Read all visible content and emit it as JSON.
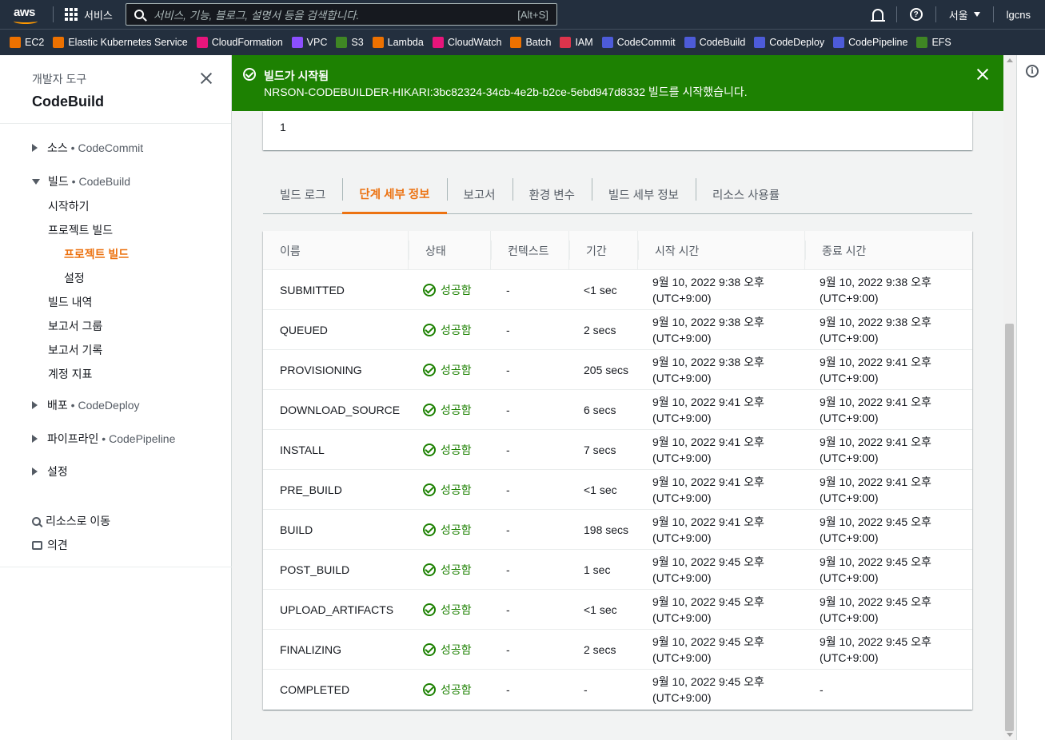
{
  "topnav": {
    "logo_text": "aws",
    "services_label": "서비스",
    "search_placeholder": "서비스, 기능, 블로그, 설명서 등을 검색합니다.",
    "search_shortcut": "[Alt+S]",
    "region": "서울",
    "account": "lgcns"
  },
  "favorites": [
    {
      "label": "EC2",
      "icon": "ec2-icon",
      "color": "#ed7100"
    },
    {
      "label": "Elastic Kubernetes Service",
      "icon": "eks-icon",
      "color": "#ed7100"
    },
    {
      "label": "CloudFormation",
      "icon": "cloudformation-icon",
      "color": "#e7157b"
    },
    {
      "label": "VPC",
      "icon": "vpc-icon",
      "color": "#8c4fff"
    },
    {
      "label": "S3",
      "icon": "s3-icon",
      "color": "#3f8624"
    },
    {
      "label": "Lambda",
      "icon": "lambda-icon",
      "color": "#ed7100"
    },
    {
      "label": "CloudWatch",
      "icon": "cloudwatch-icon",
      "color": "#e7157b"
    },
    {
      "label": "Batch",
      "icon": "batch-icon",
      "color": "#ed7100"
    },
    {
      "label": "IAM",
      "icon": "iam-icon",
      "color": "#dd344c"
    },
    {
      "label": "CodeCommit",
      "icon": "codecommit-icon",
      "color": "#4d5bd9"
    },
    {
      "label": "CodeBuild",
      "icon": "codebuild-icon",
      "color": "#4d5bd9"
    },
    {
      "label": "CodeDeploy",
      "icon": "codedeploy-icon",
      "color": "#4d5bd9"
    },
    {
      "label": "CodePipeline",
      "icon": "codepipeline-icon",
      "color": "#4d5bd9"
    },
    {
      "label": "EFS",
      "icon": "efs-icon",
      "color": "#3f8624"
    }
  ],
  "sidebar": {
    "subtitle": "개발자 도구",
    "title": "CodeBuild",
    "sections": {
      "source": {
        "label": "소스",
        "service": "CodeCommit"
      },
      "build": {
        "label": "빌드",
        "service": "CodeBuild"
      },
      "deploy": {
        "label": "배포",
        "service": "CodeDeploy"
      },
      "pipeline": {
        "label": "파이프라인",
        "service": "CodePipeline"
      },
      "settings": {
        "label": "설정"
      }
    },
    "bullet": "•",
    "build_items": {
      "getting_started": "시작하기",
      "build_projects": "프로젝트 빌드",
      "build_projects_active": "프로젝트 빌드",
      "settings": "설정",
      "build_history": "빌드 내역",
      "report_groups": "보고서 그룹",
      "report_history": "보고서 기록",
      "account_metrics": "계정 지표"
    },
    "go_to_resource": "리소스로 이동",
    "feedback": "의견"
  },
  "flash": {
    "title": "빌드가 시작됨",
    "message": "NRSON-CODEBUILDER-HIKARI:3bc82324-34cb-4e2b-b2ce-5ebd947d8332 빌드를 시작했습니다.",
    "color": "#1d8102"
  },
  "topcard_value": "1",
  "tabs": [
    "빌드 로그",
    "단계 세부 정보",
    "보고서",
    "환경 변수",
    "빌드 세부 정보",
    "리소스 사용률"
  ],
  "active_tab": "단계 세부 정보",
  "table": {
    "headers": {
      "name": "이름",
      "status": "상태",
      "context": "컨텍스트",
      "duration": "기간",
      "start": "시작 시간",
      "end": "종료 시간"
    },
    "rows": [
      {
        "name": "SUBMITTED",
        "status": "성공함",
        "context": "-",
        "duration": "<1 sec",
        "start": "9월 10, 2022 9:38 오후",
        "start_tz": "(UTC+9:00)",
        "end": "9월 10, 2022 9:38 오후",
        "end_tz": "(UTC+9:00)"
      },
      {
        "name": "QUEUED",
        "status": "성공함",
        "context": "-",
        "duration": "2 secs",
        "start": "9월 10, 2022 9:38 오후",
        "start_tz": "(UTC+9:00)",
        "end": "9월 10, 2022 9:38 오후",
        "end_tz": "(UTC+9:00)"
      },
      {
        "name": "PROVISIONING",
        "status": "성공함",
        "context": "-",
        "duration": "205 secs",
        "start": "9월 10, 2022 9:38 오후",
        "start_tz": "(UTC+9:00)",
        "end": "9월 10, 2022 9:41 오후",
        "end_tz": "(UTC+9:00)"
      },
      {
        "name": "DOWNLOAD_SOURCE",
        "status": "성공함",
        "context": "-",
        "duration": "6 secs",
        "start": "9월 10, 2022 9:41 오후",
        "start_tz": "(UTC+9:00)",
        "end": "9월 10, 2022 9:41 오후",
        "end_tz": "(UTC+9:00)"
      },
      {
        "name": "INSTALL",
        "status": "성공함",
        "context": "-",
        "duration": "7 secs",
        "start": "9월 10, 2022 9:41 오후",
        "start_tz": "(UTC+9:00)",
        "end": "9월 10, 2022 9:41 오후",
        "end_tz": "(UTC+9:00)"
      },
      {
        "name": "PRE_BUILD",
        "status": "성공함",
        "context": "-",
        "duration": "<1 sec",
        "start": "9월 10, 2022 9:41 오후",
        "start_tz": "(UTC+9:00)",
        "end": "9월 10, 2022 9:41 오후",
        "end_tz": "(UTC+9:00)"
      },
      {
        "name": "BUILD",
        "status": "성공함",
        "context": "-",
        "duration": "198 secs",
        "start": "9월 10, 2022 9:41 오후",
        "start_tz": "(UTC+9:00)",
        "end": "9월 10, 2022 9:45 오후",
        "end_tz": "(UTC+9:00)"
      },
      {
        "name": "POST_BUILD",
        "status": "성공함",
        "context": "-",
        "duration": "1 sec",
        "start": "9월 10, 2022 9:45 오후",
        "start_tz": "(UTC+9:00)",
        "end": "9월 10, 2022 9:45 오후",
        "end_tz": "(UTC+9:00)"
      },
      {
        "name": "UPLOAD_ARTIFACTS",
        "status": "성공함",
        "context": "-",
        "duration": "<1 sec",
        "start": "9월 10, 2022 9:45 오후",
        "start_tz": "(UTC+9:00)",
        "end": "9월 10, 2022 9:45 오후",
        "end_tz": "(UTC+9:00)"
      },
      {
        "name": "FINALIZING",
        "status": "성공함",
        "context": "-",
        "duration": "2 secs",
        "start": "9월 10, 2022 9:45 오후",
        "start_tz": "(UTC+9:00)",
        "end": "9월 10, 2022 9:45 오후",
        "end_tz": "(UTC+9:00)"
      },
      {
        "name": "COMPLETED",
        "status": "성공함",
        "context": "-",
        "duration": "-",
        "start": "9월 10, 2022 9:45 오후",
        "start_tz": "(UTC+9:00)",
        "end": "-",
        "end_tz": ""
      }
    ]
  },
  "colors": {
    "accent": "#ec7211",
    "success": "#1d8102",
    "nav": "#232f3e"
  }
}
